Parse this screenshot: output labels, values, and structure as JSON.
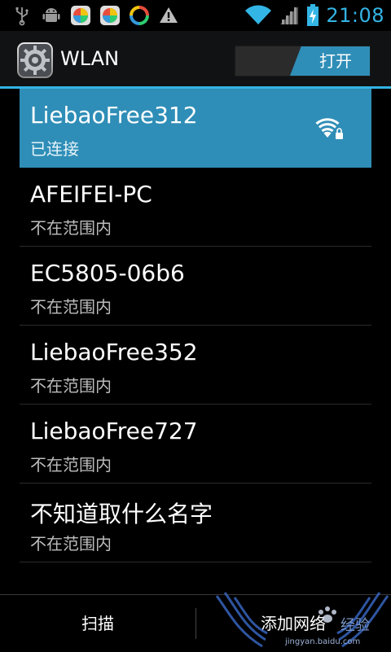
{
  "status_bar": {
    "time": "21:08",
    "icons_left": [
      "usb-icon",
      "android-debug-icon",
      "app-notification-icon",
      "app-notification-icon",
      "sync-app-icon",
      "warning-icon"
    ],
    "icons_right": [
      "wifi-signal-icon",
      "cell-signal-icon",
      "battery-charging-icon"
    ]
  },
  "action_bar": {
    "title": "WLAN",
    "switch_label": "打开",
    "switch_on": true
  },
  "networks": [
    {
      "name": "LiebaoFree312",
      "status": "已连接",
      "connected": true,
      "icon": "wifi-lock-icon"
    },
    {
      "name": "AFEIFEI-PC",
      "status": "不在范围内",
      "connected": false
    },
    {
      "name": "EC5805-06b6",
      "status": "不在范围内",
      "connected": false
    },
    {
      "name": "LiebaoFree352",
      "status": "不在范围内",
      "connected": false
    },
    {
      "name": "LiebaoFree727",
      "status": "不在范围内",
      "connected": false
    },
    {
      "name": "不知道取什么名字",
      "status": "不在范围内",
      "connected": false
    }
  ],
  "bottom_bar": {
    "scan_label": "扫描",
    "add_network_label": "添加网络",
    "watermark_text": "经验",
    "watermark_url": "jingyan.baidu.com"
  },
  "colors": {
    "accent": "#33b5e5",
    "selected_row": "#2f8eb7",
    "background": "#000000"
  }
}
